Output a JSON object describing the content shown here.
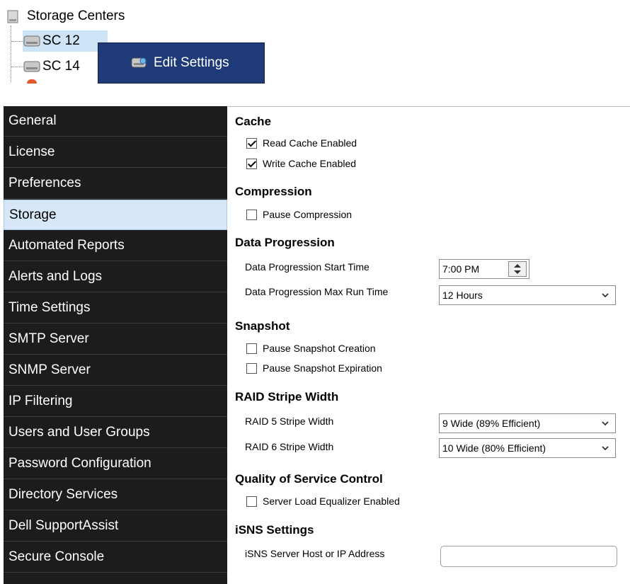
{
  "tree": {
    "root_label": "Storage Centers",
    "nodes": [
      {
        "label": "SC 12"
      },
      {
        "label": "SC 14"
      }
    ],
    "context_menu": {
      "label": "Edit Settings"
    }
  },
  "nav": {
    "items": [
      {
        "label": "General"
      },
      {
        "label": "License"
      },
      {
        "label": "Preferences"
      },
      {
        "label": "Storage"
      },
      {
        "label": "Automated Reports"
      },
      {
        "label": "Alerts and Logs"
      },
      {
        "label": "Time Settings"
      },
      {
        "label": "SMTP Server"
      },
      {
        "label": "SNMP Server"
      },
      {
        "label": "IP Filtering"
      },
      {
        "label": "Users and User Groups"
      },
      {
        "label": "Password Configuration"
      },
      {
        "label": "Directory Services"
      },
      {
        "label": "Dell SupportAssist"
      },
      {
        "label": "Secure Console"
      }
    ],
    "active": "Storage"
  },
  "settings": {
    "cache": {
      "title": "Cache",
      "read_cache_label": "Read Cache Enabled",
      "read_cache_checked": true,
      "write_cache_label": "Write Cache Enabled",
      "write_cache_checked": true
    },
    "compression": {
      "title": "Compression",
      "pause_label": "Pause Compression",
      "pause_checked": false
    },
    "data_progression": {
      "title": "Data Progression",
      "start_time_label": "Data Progression Start Time",
      "start_time_value": "7:00 PM",
      "max_run_label": "Data Progression Max Run Time",
      "max_run_value": "12 Hours"
    },
    "snapshot": {
      "title": "Snapshot",
      "pause_creation_label": "Pause Snapshot Creation",
      "pause_creation_checked": false,
      "pause_expiration_label": "Pause Snapshot Expiration",
      "pause_expiration_checked": false
    },
    "raid": {
      "title": "RAID Stripe Width",
      "raid5_label": "RAID 5 Stripe Width",
      "raid5_value": "9 Wide (89% Efficient)",
      "raid6_label": "RAID 6 Stripe Width",
      "raid6_value": "10 Wide (80% Efficient)"
    },
    "qos": {
      "title": "Quality of Service Control",
      "sle_label": "Server Load Equalizer Enabled",
      "sle_checked": false
    },
    "isns": {
      "title": "iSNS Settings",
      "host_label": "iSNS Server Host or IP Address",
      "host_value": ""
    }
  },
  "colors": {
    "nav_bg": "#1c1c1c",
    "nav_active_bg": "#d6e8f7",
    "context_menu_bg": "#1e3a78",
    "tree_selected_bg": "#cde4f7"
  }
}
